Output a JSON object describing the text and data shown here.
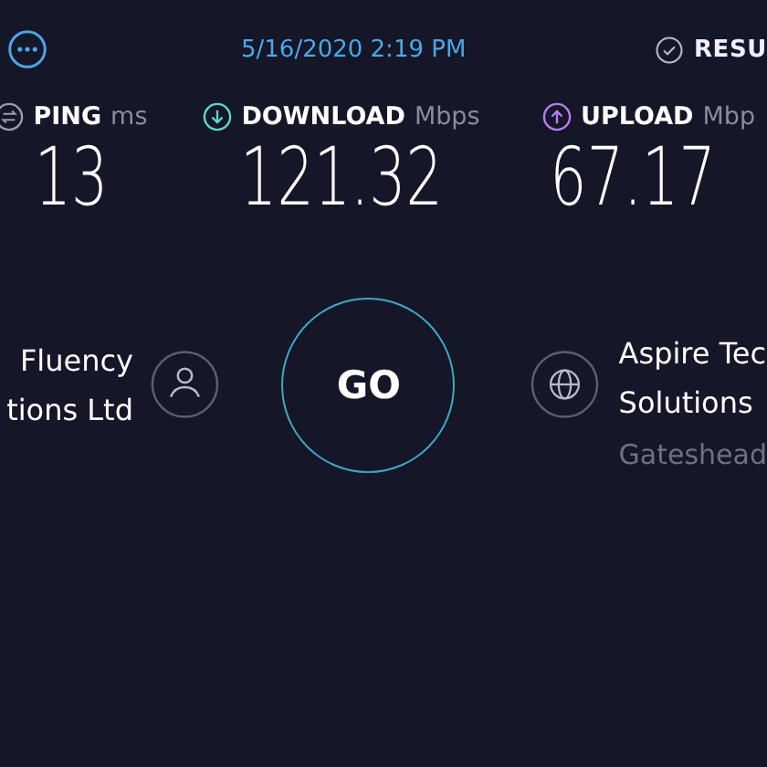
{
  "date": "5/16/2020 2:19 PM",
  "results_link": "RESU",
  "metrics": [
    {
      "kind": "ping",
      "label": "PING",
      "unit": "ms",
      "value": "13",
      "color": "#9a9cab"
    },
    {
      "kind": "download",
      "label": "DOWNLOAD",
      "unit": "Mbps",
      "value": "121.32",
      "color": "#5fd6c6"
    },
    {
      "kind": "upload",
      "label": "UPLOAD",
      "unit": "Mbp",
      "value": "67.17",
      "color": "#b77cf2"
    }
  ],
  "provider": {
    "name_lines": [
      "Fluency",
      "tions Ltd"
    ]
  },
  "go_button": "GO",
  "server": {
    "name_lines": [
      "Aspire Tec",
      "Solutions"
    ],
    "location": "Gateshead"
  }
}
